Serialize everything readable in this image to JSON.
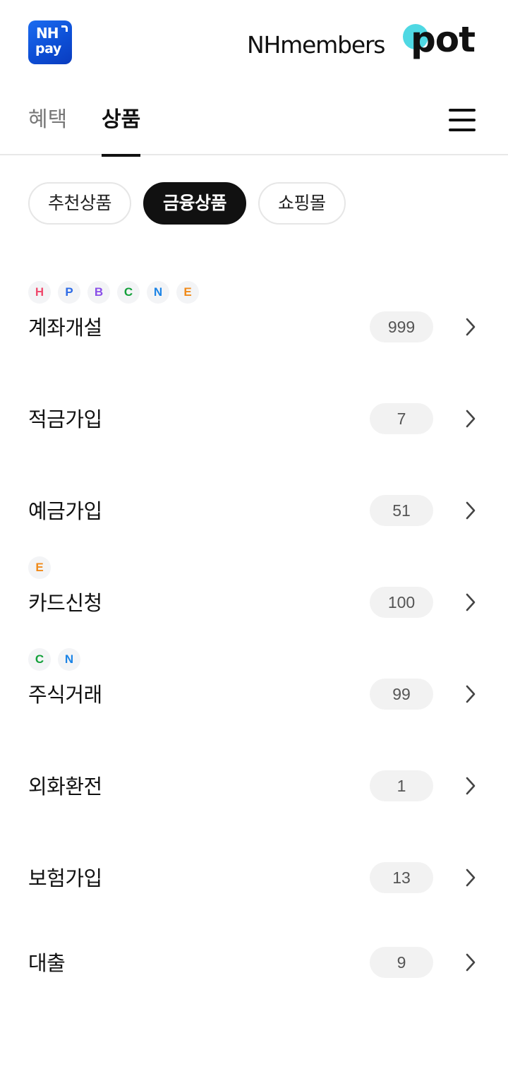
{
  "header": {
    "nh_logo_line1": "NH",
    "nh_logo_line2": "pay",
    "brand_text": "NHmembers",
    "brand_pot": "pot"
  },
  "tabs": [
    {
      "label": "혜택",
      "active": false
    },
    {
      "label": "상품",
      "active": true
    }
  ],
  "menu_icon": "hamburger-menu-icon",
  "chips": [
    {
      "label": "추천상품",
      "active": false
    },
    {
      "label": "금융상품",
      "active": true
    },
    {
      "label": "쇼핑몰",
      "active": false
    }
  ],
  "badge_colors": {
    "H": "#ef4c6e",
    "P": "#2e6be6",
    "B": "#8a4fe8",
    "C": "#13a03a",
    "N": "#1c84e6",
    "E": "#f08a1a"
  },
  "items": [
    {
      "label": "계좌개설",
      "count": "999",
      "badges": [
        "H",
        "P",
        "B",
        "C",
        "N",
        "E"
      ]
    },
    {
      "label": "적금가입",
      "count": "7",
      "badges": []
    },
    {
      "label": "예금가입",
      "count": "51",
      "badges": []
    },
    {
      "label": "카드신청",
      "count": "100",
      "badges": [
        "E"
      ]
    },
    {
      "label": "주식거래",
      "count": "99",
      "badges": [
        "C",
        "N"
      ]
    },
    {
      "label": "외화환전",
      "count": "1",
      "badges": []
    },
    {
      "label": "보험가입",
      "count": "13",
      "badges": []
    },
    {
      "label": "대출",
      "count": "9",
      "badges": []
    }
  ]
}
